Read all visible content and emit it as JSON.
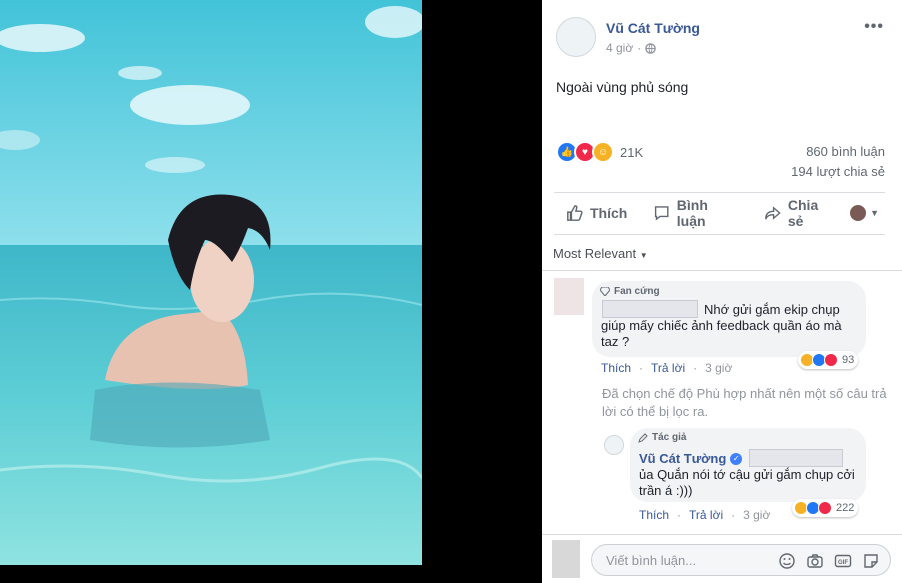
{
  "post": {
    "author": "Vũ Cát Tường",
    "time": "4 giờ",
    "text": "Ngoài vùng phủ sóng",
    "reaction_count": "21K",
    "comment_count": "860 bình luận",
    "share_count": "194 lượt chia sẻ"
  },
  "actions": {
    "like": "Thích",
    "comment": "Bình luận",
    "share": "Chia sẻ"
  },
  "sort_label": "Most Relevant",
  "comments": [
    {
      "badge": "Fan cứng",
      "text_line1": "Nhớ gửi gắm ekip chụp",
      "text_line2": "giúp mấy chiếc ảnh feedback quần áo mà",
      "text_line3": "taz ?",
      "like": "Thích",
      "reply": "Trả lời",
      "time": "3 giờ",
      "reaction_count": "93"
    }
  ],
  "filter_notice": "Đã chọn chế độ Phù hợp nhất nên một số câu trả lời có thể bị lọc ra.",
  "reply": {
    "badge": "Tác giả",
    "author": "Vũ Cát Tường",
    "text_line1": "ủa Quắn nói tớ cậu gửi gắm chụp cởi",
    "text_line2": "trần á :)))",
    "like": "Thích",
    "reply": "Trả lời",
    "time": "3 giờ",
    "reaction_count": "222"
  },
  "composer": {
    "placeholder": "Viết bình luận..."
  },
  "colors": {
    "link": "#385898",
    "like": "#2078f4",
    "love": "#f0284a",
    "haha": "#f7b125"
  }
}
